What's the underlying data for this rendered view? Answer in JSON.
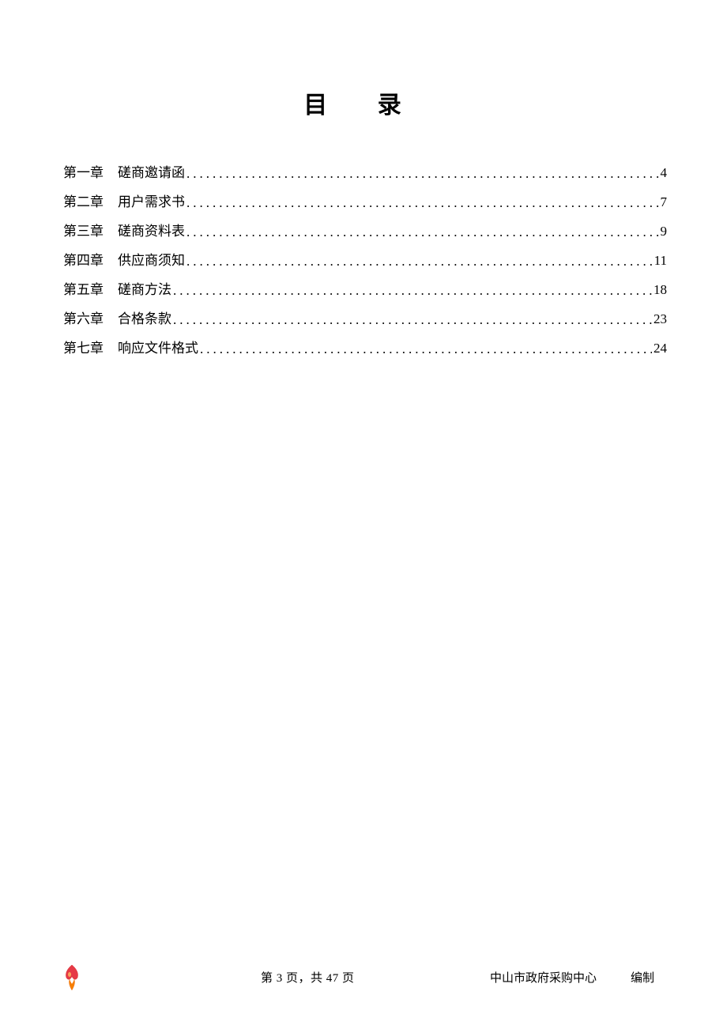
{
  "title": "目 录",
  "toc": [
    {
      "chapter": "第一章",
      "title": "磋商邀请函",
      "page": "4"
    },
    {
      "chapter": "第二章",
      "title": "用户需求书",
      "page": "7"
    },
    {
      "chapter": "第三章",
      "title": "磋商资料表",
      "page": "9"
    },
    {
      "chapter": "第四章",
      "title": "供应商须知",
      "page": "11"
    },
    {
      "chapter": "第五章",
      "title": "磋商方法",
      "page": "18"
    },
    {
      "chapter": "第六章",
      "title": "合格条款",
      "page": "23"
    },
    {
      "chapter": "第七章",
      "title": "响应文件格式",
      "page": "24"
    }
  ],
  "footer": {
    "pageinfo": "第 3 页，共 47 页",
    "org": "中山市政府采购中心",
    "compile": "编制"
  }
}
